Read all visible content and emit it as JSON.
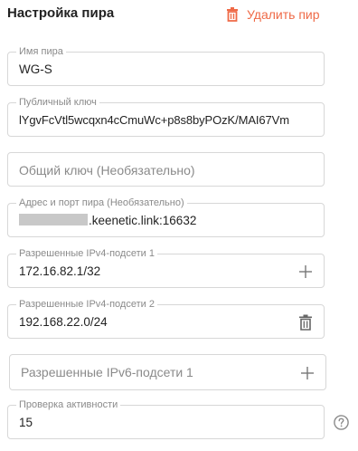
{
  "header": {
    "title": "Настройка пира",
    "delete_label": "Удалить пир"
  },
  "fields": {
    "peer_name": {
      "label": "Имя пира",
      "value": "WG-S"
    },
    "public_key": {
      "label": "Публичный ключ",
      "value": "lYgvFcVtl5wcqxn4cCmuWc+p8s8byPOzK/MAI67Vm"
    },
    "preshared_key": {
      "placeholder": "Общий ключ (Необязательно)"
    },
    "endpoint": {
      "label": "Адрес и порт пира (Необязательно)",
      "value": ".keenetic.link:16632"
    },
    "ipv4_subnet_1": {
      "label": "Разрешенные IPv4-подсети 1",
      "value": "172.16.82.1/32"
    },
    "ipv4_subnet_2": {
      "label": "Разрешенные IPv4-подсети 2",
      "value": "192.168.22.0/24"
    },
    "ipv6_subnet_1": {
      "placeholder": "Разрешенные IPv6-подсети 1"
    },
    "keepalive": {
      "label": "Проверка активности",
      "value": "15"
    }
  },
  "icons": {
    "delete": "trash-icon",
    "add": "plus-icon",
    "remove": "trash-icon",
    "help": "question-circle-icon"
  },
  "colors": {
    "accent": "#ef6a47",
    "label": "#8a8a8a",
    "border": "#d7d7d7"
  }
}
